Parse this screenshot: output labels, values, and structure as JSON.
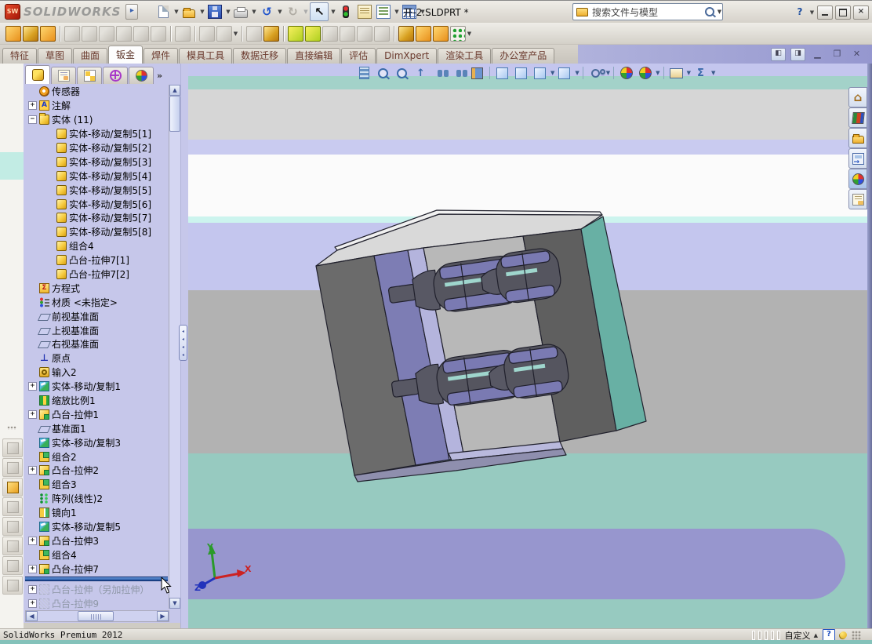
{
  "titlebar": {
    "brand": "SOLIDWORKS",
    "title": "开-2.SLDPRT *",
    "search_text": "搜索文件与模型",
    "help_glyph": "?"
  },
  "toolbar_main": {
    "icons": [
      {
        "name": "new-file-icon",
        "cls": "ic-new",
        "dd": true
      },
      {
        "name": "open-icon",
        "cls": "ic-open",
        "dd": true
      },
      {
        "name": "save-icon",
        "cls": "ic-save",
        "dd": true
      },
      {
        "name": "print-icon",
        "cls": "ic-print",
        "dd": true
      },
      {
        "name": "undo-icon",
        "glyph": "↺",
        "color": "#2255cc",
        "dd": true
      },
      {
        "name": "redo-icon",
        "glyph": "↻",
        "color": "#b0aca4",
        "dd": true,
        "disabled": true
      },
      {
        "name": "select-icon",
        "glyph": "↖",
        "color": "#111",
        "boxed": true,
        "dd": true
      },
      {
        "name": "traffic-light-icon",
        "cls": "ic-traffic"
      },
      {
        "name": "properties-icon",
        "cls": "ic-props"
      },
      {
        "name": "options-icon",
        "cls": "ic-opts",
        "dd": true
      },
      {
        "name": "table-icon",
        "cls": "ic-table",
        "dd": true
      }
    ]
  },
  "toolbar_sheetmetal": {
    "icons": [
      {
        "name": "base-flange-icon",
        "v": "c0"
      },
      {
        "name": "convert-to-sheet-metal-icon",
        "v": "c1"
      },
      {
        "name": "lofted-bend-icon",
        "v": "c0"
      },
      {
        "sep": true
      },
      {
        "name": "edge-flange-icon",
        "v": "g"
      },
      {
        "name": "miter-flange-icon",
        "v": "g"
      },
      {
        "name": "hem-icon",
        "v": "g"
      },
      {
        "name": "jog-icon",
        "v": "g"
      },
      {
        "name": "sketched-bend-icon",
        "v": "g"
      },
      {
        "name": "cross-break-icon",
        "v": "g"
      },
      {
        "sep": true
      },
      {
        "name": "extruded-cut-icon",
        "v": "g"
      },
      {
        "sep": true
      },
      {
        "name": "simple-hole-icon",
        "v": "g"
      },
      {
        "name": "corner-icon",
        "v": "g",
        "dd": true
      },
      {
        "sep": true
      },
      {
        "name": "unfold-icon",
        "v": "g"
      },
      {
        "name": "forming-tool-icon",
        "v": "c1"
      },
      {
        "sep": true
      },
      {
        "name": "extruded-boss-icon",
        "v": "c2"
      },
      {
        "name": "extruded-base-icon",
        "v": "c2"
      },
      {
        "name": "flat-pattern-icon",
        "v": "g"
      },
      {
        "name": "fold-icon",
        "v": "g"
      },
      {
        "name": "vent-icon",
        "v": "g"
      },
      {
        "name": "no-solve-icon",
        "v": "g"
      },
      {
        "sep": true
      },
      {
        "name": "insert-bends-icon",
        "v": "c1"
      },
      {
        "name": "rip-icon",
        "v": "c0"
      },
      {
        "name": "welded-corner-icon",
        "v": "c0"
      },
      {
        "name": "linear-pattern-icon",
        "v": "c3",
        "dd": true
      }
    ]
  },
  "ribbon_tabs": {
    "active": "钣金",
    "items": [
      "特征",
      "草图",
      "曲面",
      "钣金",
      "焊件",
      "模具工具",
      "数据迁移",
      "直接编辑",
      "评估",
      "DimXpert",
      "渲染工具",
      "办公室产品"
    ]
  },
  "featuremanager": {
    "tabs": [
      "featuremanager-tree-tab",
      "propertymanager-tab",
      "configurationmanager-tab",
      "dimxpertmanager-tab",
      "displaymanager-tab"
    ],
    "more_label": "»"
  },
  "feature_tree": {
    "items": [
      {
        "label": "传感器",
        "icon": "sensor",
        "indent": 1
      },
      {
        "label": "注解",
        "icon": "annotations",
        "indent": 1,
        "exp": "+"
      },
      {
        "label": "实体 (11)",
        "icon": "folder",
        "indent": 1,
        "exp": "-"
      },
      {
        "label": "实体-移动/复制5[1]",
        "icon": "body",
        "indent": 2
      },
      {
        "label": "实体-移动/复制5[2]",
        "icon": "body",
        "indent": 2
      },
      {
        "label": "实体-移动/复制5[3]",
        "icon": "body",
        "indent": 2
      },
      {
        "label": "实体-移动/复制5[4]",
        "icon": "body",
        "indent": 2
      },
      {
        "label": "实体-移动/复制5[5]",
        "icon": "body",
        "indent": 2
      },
      {
        "label": "实体-移动/复制5[6]",
        "icon": "body",
        "indent": 2
      },
      {
        "label": "实体-移动/复制5[7]",
        "icon": "body",
        "indent": 2
      },
      {
        "label": "实体-移动/复制5[8]",
        "icon": "body",
        "indent": 2
      },
      {
        "label": "组合4",
        "icon": "body",
        "indent": 2
      },
      {
        "label": "凸台-拉伸7[1]",
        "icon": "body",
        "indent": 2
      },
      {
        "label": "凸台-拉伸7[2]",
        "icon": "body",
        "indent": 2
      },
      {
        "label": "方程式",
        "icon": "equations",
        "indent": 1
      },
      {
        "label": "材质 <未指定>",
        "icon": "material",
        "indent": 1
      },
      {
        "label": "前视基准面",
        "icon": "plane",
        "indent": 1
      },
      {
        "label": "上视基准面",
        "icon": "plane",
        "indent": 1
      },
      {
        "label": "右视基准面",
        "icon": "plane",
        "indent": 1
      },
      {
        "label": "原点",
        "icon": "origin",
        "indent": 1
      },
      {
        "label": "输入2",
        "icon": "imported",
        "indent": 1
      },
      {
        "label": "实体-移动/复制1",
        "icon": "movecopy",
        "indent": 1,
        "exp": "+"
      },
      {
        "label": "缩放比例1",
        "icon": "scale",
        "indent": 1
      },
      {
        "label": "凸台-拉伸1",
        "icon": "extrude",
        "indent": 1,
        "exp": "+"
      },
      {
        "label": "基准面1",
        "icon": "plane",
        "indent": 1
      },
      {
        "label": "实体-移动/复制3",
        "icon": "movecopy",
        "indent": 1
      },
      {
        "label": "组合2",
        "icon": "combine",
        "indent": 1
      },
      {
        "label": "凸台-拉伸2",
        "icon": "extrude",
        "indent": 1,
        "exp": "+"
      },
      {
        "label": "组合3",
        "icon": "combine",
        "indent": 1
      },
      {
        "label": "阵列(线性)2",
        "icon": "pattern",
        "indent": 1
      },
      {
        "label": "镜向1",
        "icon": "mirror",
        "indent": 1
      },
      {
        "label": "实体-移动/复制5",
        "icon": "movecopy",
        "indent": 1
      },
      {
        "label": "凸台-拉伸3",
        "icon": "extrude",
        "indent": 1,
        "exp": "+"
      },
      {
        "label": "组合4",
        "icon": "combine",
        "indent": 1
      },
      {
        "label": "凸台-拉伸7",
        "icon": "extrude",
        "indent": 1,
        "exp": "+",
        "rollback_after": true
      },
      {
        "label": "凸台-拉伸（另加拉伸）",
        "icon": "ghost",
        "indent": 1,
        "exp": "+",
        "grayed": true
      },
      {
        "label": "凸台-拉伸9",
        "icon": "ghost",
        "indent": 1,
        "exp": "+",
        "grayed": true
      }
    ]
  },
  "headsup": {
    "icons": [
      {
        "name": "whole-view-icon",
        "cls": "hu-bars"
      },
      {
        "name": "zoom-to-fit-icon",
        "cls": "hu-mag"
      },
      {
        "name": "zoom-to-area-icon",
        "cls": "hu-mag"
      },
      {
        "name": "previous-view-icon",
        "cls": "hu-arrow",
        "glyph": "↑"
      },
      {
        "name": "look-at-icon",
        "cls": "hu-bino"
      },
      {
        "name": "normal-to-icon",
        "cls": "hu-bino"
      },
      {
        "name": "section-view-icon",
        "cls": "hu-sect"
      },
      {
        "sep": true
      },
      {
        "name": "display-state-icon",
        "cls": "hu-cube"
      },
      {
        "name": "display-style-icon",
        "cls": "hu-cube"
      },
      {
        "name": "view-orientation-icon",
        "cls": "hu-cube",
        "dd": true
      },
      {
        "name": "show-display-style-icon",
        "cls": "hu-cube",
        "dd": true
      },
      {
        "sep": true
      },
      {
        "name": "hide-show-items-icon",
        "cls": "hu-glasses",
        "dd": true
      },
      {
        "sep": true
      },
      {
        "name": "apply-scene-icon",
        "cls": "hu-ball"
      },
      {
        "name": "edit-appearance-icon",
        "cls": "hu-ball",
        "dd": true
      },
      {
        "sep": true
      },
      {
        "name": "view-settings-icon",
        "cls": "hu-mon",
        "dd": true
      },
      {
        "name": "instant3d-icon",
        "cls": "hu-sigma",
        "glyph": "Σ",
        "dd": true
      }
    ]
  },
  "left_toolbar": {
    "icons": [
      {
        "name": "new-note-icon"
      },
      {
        "name": "edit-note-icon"
      },
      {
        "name": "open-note-folder-icon",
        "colored": true
      },
      {
        "name": "insert-chart-icon"
      },
      {
        "name": "spell-check-icon"
      },
      {
        "name": "lock-note-icon"
      },
      {
        "name": "picture-icon"
      },
      {
        "name": "annotation-tool-icon"
      }
    ]
  },
  "taskpane": {
    "buttons": [
      {
        "name": "solidworks-resources-button",
        "icon": "tpi-home",
        "glyph": "⌂"
      },
      {
        "name": "design-library-button",
        "icon": "tpi-books"
      },
      {
        "name": "file-explorer-button",
        "icon": "tpi-folder"
      },
      {
        "name": "view-palette-button",
        "icon": "tpi-palette"
      },
      {
        "name": "appearances-scenes-button",
        "icon": "tpi-ball",
        "pressed": true
      },
      {
        "name": "custom-properties-button",
        "icon": "tpi-sheet"
      }
    ]
  },
  "viewport": {
    "triad": {
      "x": "X",
      "y": "Y",
      "z": "Z"
    }
  },
  "statusbar": {
    "left": "SolidWorks Premium 2012",
    "custom_label": "自定义",
    "help_glyph": "?"
  },
  "window_buttons": {
    "minimize_name": "minimize-button",
    "restore_name": "restore-button",
    "close_name": "close-button"
  }
}
